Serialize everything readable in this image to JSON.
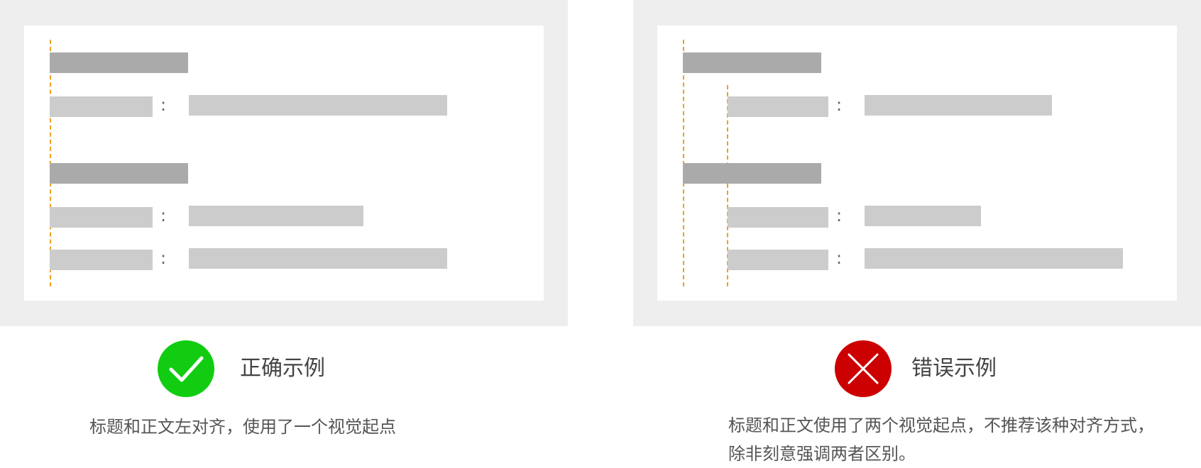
{
  "colors": {
    "panel_bg": "#eeeeee",
    "card_bg": "#ffffff",
    "title_bar": "#aaaaaa",
    "text_bar": "#cccccc",
    "guide": "#f0a020",
    "correct": "#11cc11",
    "wrong": "#cc0000"
  },
  "left": {
    "icon": "check-icon",
    "title": "正确示例",
    "description": "标题和正文左对齐，使用了一个视觉起点",
    "rows": [
      ":",
      ":",
      ":"
    ]
  },
  "right": {
    "icon": "close-icon",
    "title": "错误示例",
    "description": "标题和正文使用了两个视觉起点，不推荐该种对齐方式，除非刻意强调两者区别。",
    "rows": [
      ":",
      ":",
      ":"
    ]
  }
}
